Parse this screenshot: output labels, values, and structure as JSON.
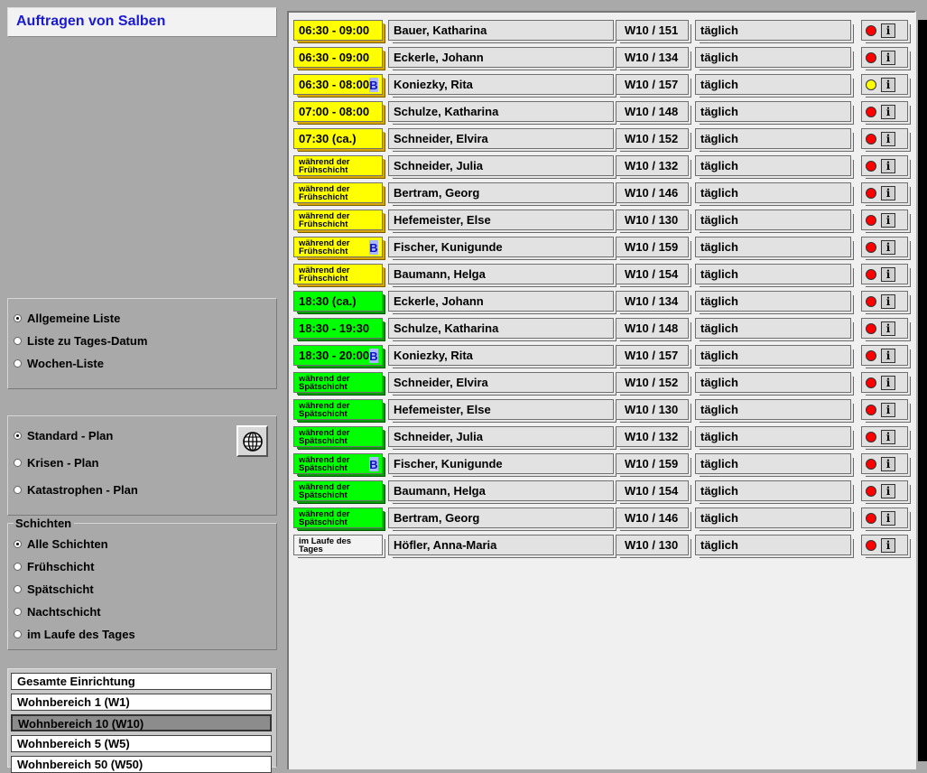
{
  "window_title": "Auftragen von Salben",
  "list_options": [
    {
      "label": "Allgemeine Liste",
      "selected": true
    },
    {
      "label": "Liste zu Tages-Datum",
      "selected": false
    },
    {
      "label": "Wochen-Liste",
      "selected": false
    }
  ],
  "plan_options": [
    {
      "label": "Standard - Plan",
      "selected": true
    },
    {
      "label": "Krisen - Plan",
      "selected": false
    },
    {
      "label": "Katastrophen - Plan",
      "selected": false
    }
  ],
  "shifts": {
    "legend": "Schichten",
    "options": [
      {
        "label": "Alle Schichten",
        "selected": true
      },
      {
        "label": "Frühschicht",
        "selected": false
      },
      {
        "label": "Spätschicht",
        "selected": false
      },
      {
        "label": "Nachtschicht",
        "selected": false
      },
      {
        "label": "im Laufe des Tages",
        "selected": false
      }
    ]
  },
  "bereiche": [
    {
      "label": "Gesamte Einrichtung",
      "selected": false
    },
    {
      "label": "Wohnbereich 1 (W1)",
      "selected": false
    },
    {
      "label": "Wohnbereich 10 (W10)",
      "selected": true
    },
    {
      "label": "Wohnbereich 5 (W5)",
      "selected": false
    },
    {
      "label": "Wohnbereich 50 (W50)",
      "selected": false
    }
  ],
  "icons": {
    "globe": "globe-icon",
    "info": "info-icon"
  },
  "colors": {
    "title": "#1a1ad0",
    "early_shift": "#ffff00",
    "late_shift": "#00ff00",
    "status_red": "#ff0000",
    "status_yellow": "#ffff00"
  },
  "tasks": [
    {
      "time": "06:30 - 09:00",
      "time_style": "yellow",
      "small": false,
      "badge": "",
      "name": "Bauer, Katharina",
      "room": "W10 / 151",
      "freq": "täglich",
      "status": "red"
    },
    {
      "time": "06:30 - 09:00",
      "time_style": "yellow",
      "small": false,
      "badge": "",
      "name": "Eckerle, Johann",
      "room": "W10 / 134",
      "freq": "täglich",
      "status": "red"
    },
    {
      "time": "06:30 - 08:00",
      "time_style": "yellow",
      "small": false,
      "badge": "B",
      "name": "Koniezky, Rita",
      "room": "W10 / 157",
      "freq": "täglich",
      "status": "yellow"
    },
    {
      "time": "07:00 - 08:00",
      "time_style": "yellow",
      "small": false,
      "badge": "",
      "name": "Schulze, Katharina",
      "room": "W10 / 148",
      "freq": "täglich",
      "status": "red"
    },
    {
      "time": "07:30 (ca.)",
      "time_style": "yellow",
      "small": false,
      "badge": "",
      "name": "Schneider, Elvira",
      "room": "W10 / 152",
      "freq": "täglich",
      "status": "red"
    },
    {
      "time": "während der Frühschicht",
      "time_style": "yellow",
      "small": true,
      "badge": "",
      "name": "Schneider, Julia",
      "room": "W10 / 132",
      "freq": "täglich",
      "status": "red"
    },
    {
      "time": "während der Frühschicht",
      "time_style": "yellow",
      "small": true,
      "badge": "",
      "name": "Bertram, Georg",
      "room": "W10 / 146",
      "freq": "täglich",
      "status": "red"
    },
    {
      "time": "während der Frühschicht",
      "time_style": "yellow",
      "small": true,
      "badge": "",
      "name": "Hefemeister, Else",
      "room": "W10 / 130",
      "freq": "täglich",
      "status": "red"
    },
    {
      "time": "während der Frühschicht",
      "time_style": "yellow",
      "small": true,
      "badge": "B",
      "name": "Fischer, Kunigunde",
      "room": "W10 / 159",
      "freq": "täglich",
      "status": "red"
    },
    {
      "time": "während der Frühschicht",
      "time_style": "yellow",
      "small": true,
      "badge": "",
      "name": "Baumann, Helga",
      "room": "W10 / 154",
      "freq": "täglich",
      "status": "red"
    },
    {
      "time": "18:30 (ca.)",
      "time_style": "green",
      "small": false,
      "badge": "",
      "name": "Eckerle, Johann",
      "room": "W10 / 134",
      "freq": "täglich",
      "status": "red"
    },
    {
      "time": "18:30 - 19:30",
      "time_style": "green",
      "small": false,
      "badge": "",
      "name": "Schulze, Katharina",
      "room": "W10 / 148",
      "freq": "täglich",
      "status": "red"
    },
    {
      "time": "18:30 - 20:00",
      "time_style": "green",
      "small": false,
      "badge": "B",
      "name": "Koniezky, Rita",
      "room": "W10 / 157",
      "freq": "täglich",
      "status": "red"
    },
    {
      "time": "während der Spätschicht",
      "time_style": "green",
      "small": true,
      "badge": "",
      "name": "Schneider, Elvira",
      "room": "W10 / 152",
      "freq": "täglich",
      "status": "red"
    },
    {
      "time": "während der Spätschicht",
      "time_style": "green",
      "small": true,
      "badge": "",
      "name": "Hefemeister, Else",
      "room": "W10 / 130",
      "freq": "täglich",
      "status": "red"
    },
    {
      "time": "während der Spätschicht",
      "time_style": "green",
      "small": true,
      "badge": "",
      "name": "Schneider, Julia",
      "room": "W10 / 132",
      "freq": "täglich",
      "status": "red"
    },
    {
      "time": "während der Spätschicht",
      "time_style": "green",
      "small": true,
      "badge": "B",
      "name": "Fischer, Kunigunde",
      "room": "W10 / 159",
      "freq": "täglich",
      "status": "red"
    },
    {
      "time": "während der Spätschicht",
      "time_style": "green",
      "small": true,
      "badge": "",
      "name": "Baumann, Helga",
      "room": "W10 / 154",
      "freq": "täglich",
      "status": "red"
    },
    {
      "time": "während der Spätschicht",
      "time_style": "green",
      "small": true,
      "badge": "",
      "name": "Bertram, Georg",
      "room": "W10 / 146",
      "freq": "täglich",
      "status": "red"
    },
    {
      "time": "im Laufe des Tages",
      "time_style": "white",
      "small": true,
      "badge": "",
      "name": "Höfler, Anna-Maria",
      "room": "W10 / 130",
      "freq": "täglich",
      "status": "red"
    }
  ]
}
